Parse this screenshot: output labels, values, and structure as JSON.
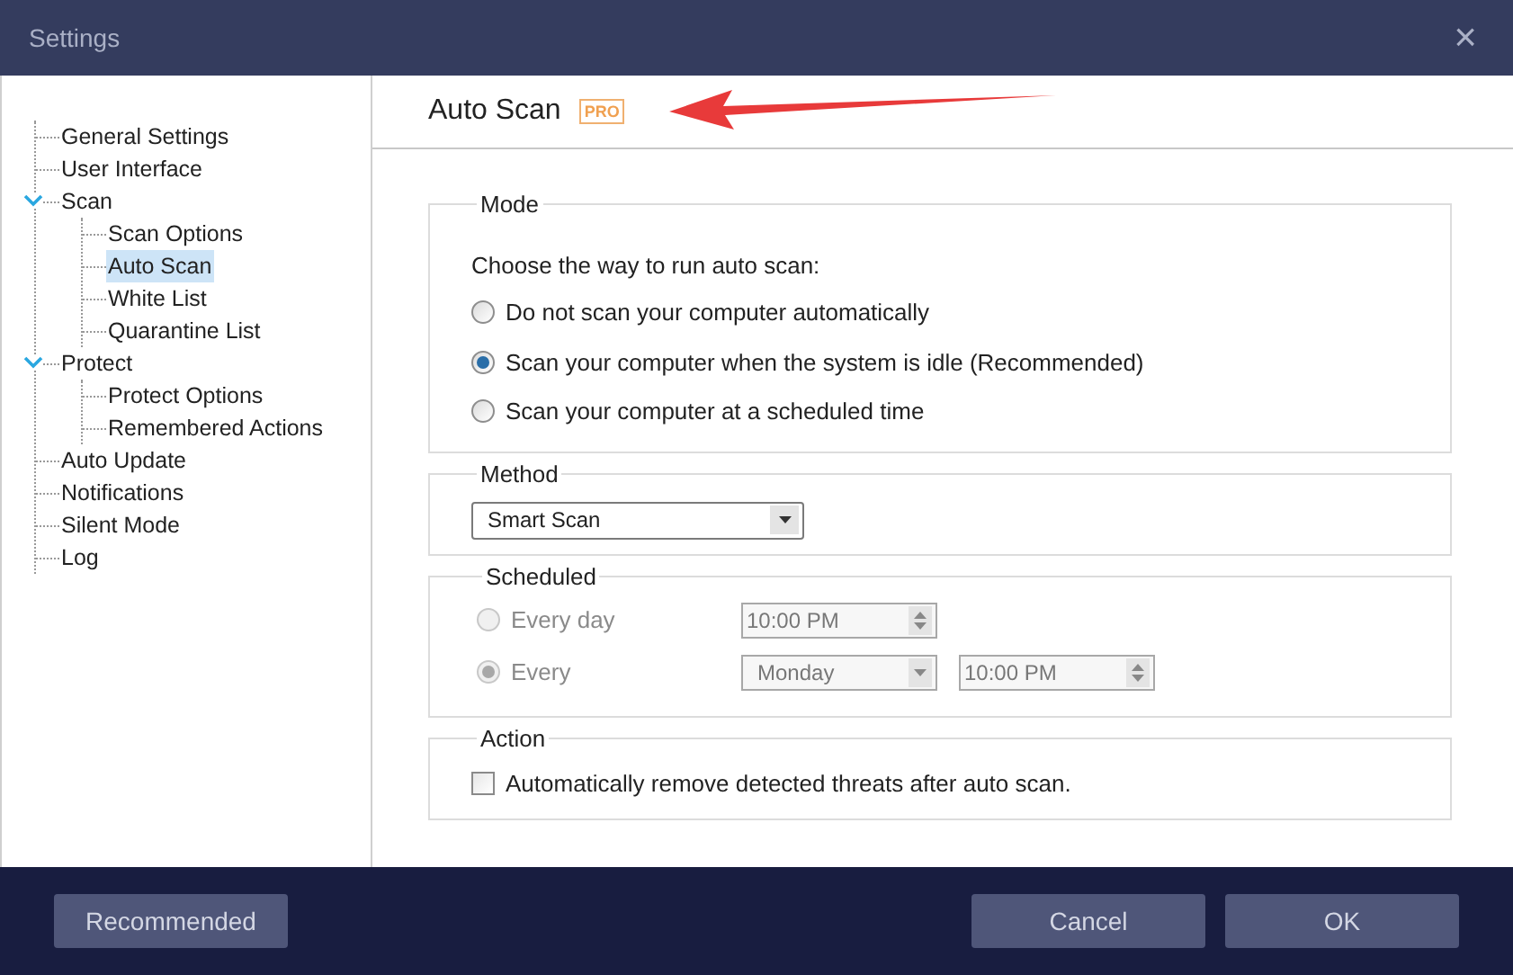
{
  "window": {
    "title": "Settings",
    "close": "×"
  },
  "sidebar": {
    "items": [
      {
        "label": "General Settings",
        "selected": false
      },
      {
        "label": "User Interface",
        "selected": false
      },
      {
        "label": "Scan",
        "selected": false,
        "expanded": true,
        "children": [
          {
            "label": "Scan Options",
            "selected": false
          },
          {
            "label": "Auto Scan",
            "selected": true
          },
          {
            "label": "White List",
            "selected": false
          },
          {
            "label": "Quarantine List",
            "selected": false
          }
        ]
      },
      {
        "label": "Protect",
        "selected": false,
        "expanded": true,
        "children": [
          {
            "label": "Protect Options",
            "selected": false
          },
          {
            "label": "Remembered Actions",
            "selected": false
          }
        ]
      },
      {
        "label": "Auto Update",
        "selected": false
      },
      {
        "label": "Notifications",
        "selected": false
      },
      {
        "label": "Silent Mode",
        "selected": false
      },
      {
        "label": "Log",
        "selected": false
      }
    ]
  },
  "header": {
    "title": "Auto Scan",
    "badge": "PRO"
  },
  "mode": {
    "legend": "Mode",
    "prompt": "Choose the way to run auto scan:",
    "options": [
      {
        "label": "Do not scan your computer automatically",
        "selected": false
      },
      {
        "label": "Scan your computer when the system is idle (Recommended)",
        "selected": true
      },
      {
        "label": "Scan your computer at a scheduled time",
        "selected": false
      }
    ]
  },
  "method": {
    "legend": "Method",
    "value": "Smart Scan"
  },
  "scheduled": {
    "legend": "Scheduled",
    "disabled": true,
    "options": [
      {
        "label": "Every day",
        "selected": false,
        "time": "10:00 PM"
      },
      {
        "label": "Every",
        "selected": true,
        "day": "Monday",
        "time": "10:00 PM"
      }
    ]
  },
  "action": {
    "legend": "Action",
    "checkbox": {
      "label": "Automatically remove detected threats after auto scan.",
      "checked": false
    }
  },
  "buttons": [
    {
      "label": "Recommended"
    },
    {
      "label": "Cancel"
    },
    {
      "label": "OK"
    }
  ]
}
